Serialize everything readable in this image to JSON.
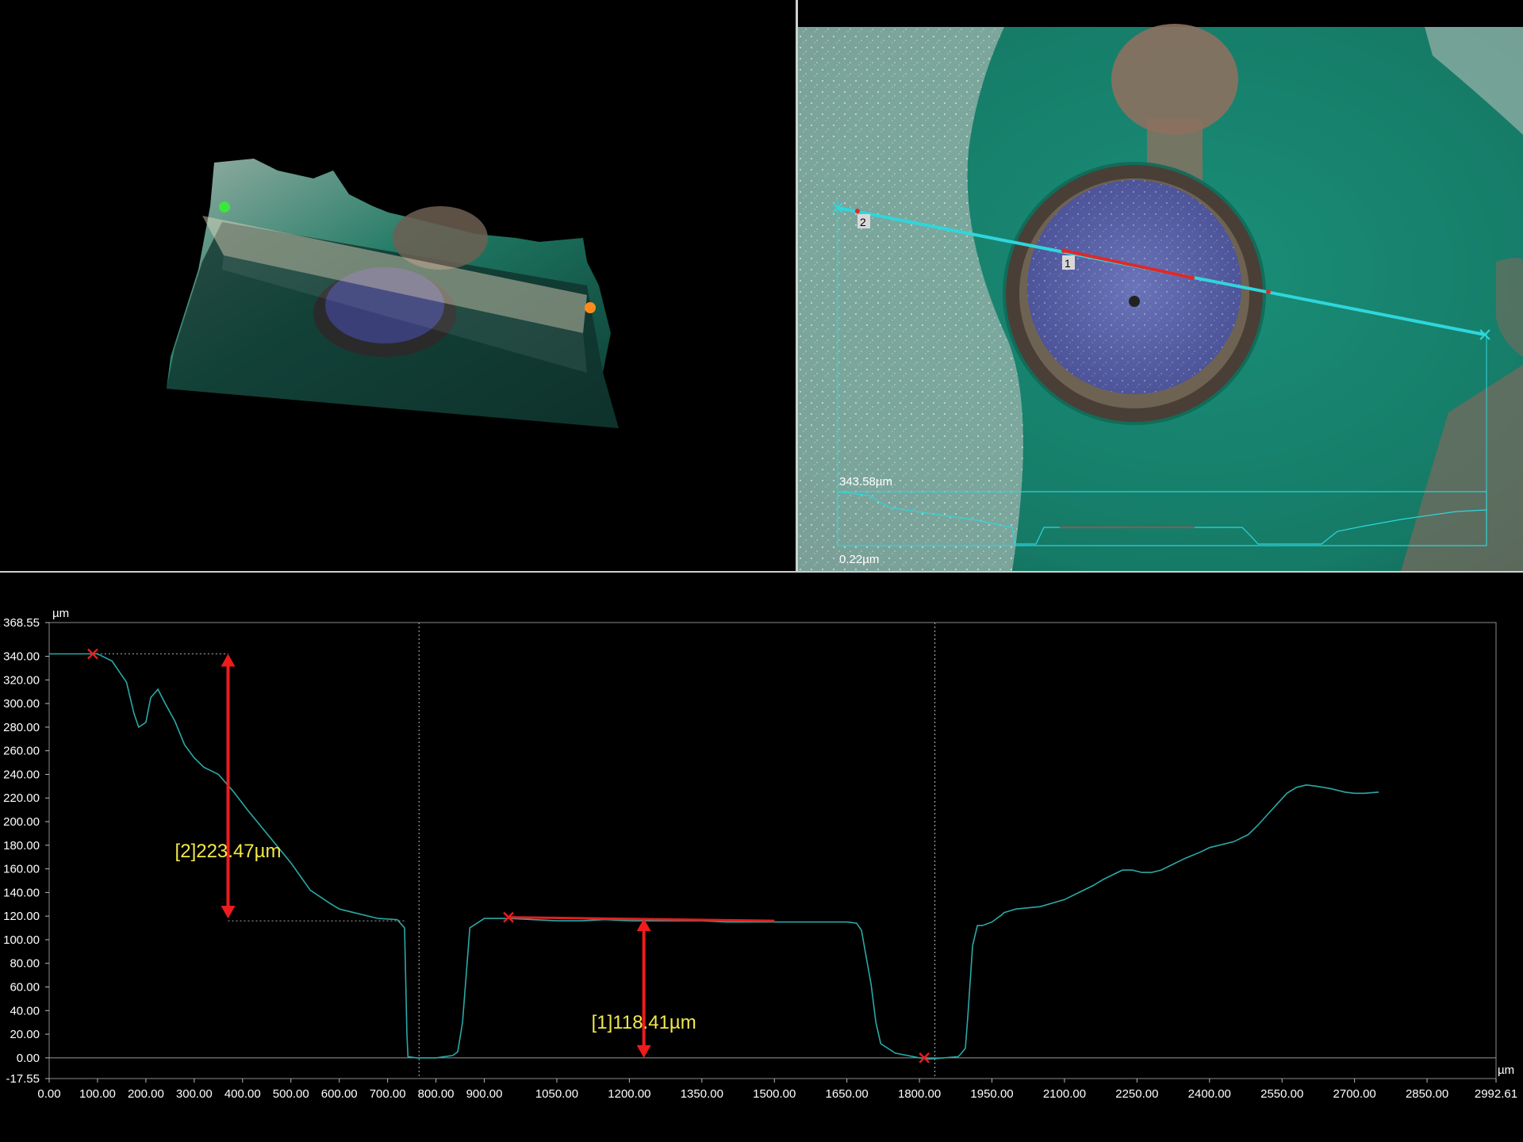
{
  "view_2d": {
    "profile_inset_max": "343.58µm",
    "profile_inset_min": "0.22µm",
    "marker_1": "1",
    "marker_2": "2"
  },
  "chart_data": {
    "type": "line",
    "xlabel": "µm",
    "ylabel": "µm",
    "xlim": [
      0,
      2992.61
    ],
    "ylim": [
      -17.55,
      368.55
    ],
    "x_ticks": [
      "0.00",
      "100.00",
      "200.00",
      "300.00",
      "400.00",
      "500.00",
      "600.00",
      "700.00",
      "800.00",
      "900.00",
      "1050.00",
      "1200.00",
      "1350.00",
      "1500.00",
      "1650.00",
      "1800.00",
      "1950.00",
      "2100.00",
      "2250.00",
      "2400.00",
      "2550.00",
      "2700.00",
      "2850.00",
      "2992.61"
    ],
    "x_tick_values": [
      0,
      100,
      200,
      300,
      400,
      500,
      600,
      700,
      800,
      900,
      1050,
      1200,
      1350,
      1500,
      1650,
      1800,
      1950,
      2100,
      2250,
      2400,
      2550,
      2700,
      2850,
      2992.61
    ],
    "y_ticks": [
      "368.55",
      "340.00",
      "320.00",
      "300.00",
      "280.00",
      "260.00",
      "240.00",
      "220.00",
      "200.00",
      "180.00",
      "160.00",
      "140.00",
      "120.00",
      "100.00",
      "80.00",
      "60.00",
      "40.00",
      "20.00",
      "0.00",
      "-17.55"
    ],
    "y_tick_values": [
      368.55,
      340,
      320,
      300,
      280,
      260,
      240,
      220,
      200,
      180,
      160,
      140,
      120,
      100,
      80,
      60,
      40,
      20,
      0,
      -17.55
    ],
    "series": [
      {
        "x": [
          0,
          100,
          130,
          160,
          175,
          185,
          200,
          210,
          225,
          240,
          260,
          280,
          300,
          320,
          350,
          380,
          410,
          450,
          500,
          540,
          580,
          600,
          640,
          680,
          720,
          735,
          740,
          742,
          760,
          800,
          835,
          845,
          855,
          870,
          900,
          950,
          1000,
          1050,
          1100,
          1150,
          1200,
          1250,
          1300,
          1350,
          1400,
          1450,
          1500,
          1550,
          1600,
          1650,
          1670,
          1680,
          1700,
          1710,
          1720,
          1750,
          1800,
          1820,
          1850,
          1880,
          1885,
          1895,
          1900,
          1910,
          1920,
          1930,
          1950,
          1960,
          1970,
          1975,
          2000,
          2050,
          2100,
          2130,
          2160,
          2180,
          2200,
          2220,
          2240,
          2260,
          2280,
          2300,
          2320,
          2350,
          2380,
          2400,
          2450,
          2480,
          2500,
          2520,
          2540,
          2560,
          2580,
          2600,
          2620,
          2650,
          2680,
          2700,
          2720,
          2750
        ],
        "y": [
          342,
          342,
          336,
          318,
          292,
          280,
          284,
          305,
          312,
          300,
          285,
          265,
          254,
          246,
          240,
          226,
          210,
          190,
          165,
          142,
          131,
          126,
          122,
          118,
          117,
          110,
          20,
          1,
          0,
          0,
          2,
          5,
          30,
          110,
          118,
          118,
          117,
          116,
          116,
          117,
          116,
          116,
          116,
          116,
          115,
          115,
          115,
          115,
          115,
          115,
          114,
          108,
          62,
          30,
          12,
          4,
          0,
          -1,
          0,
          1,
          3,
          8,
          35,
          95,
          112,
          112,
          115,
          118,
          121,
          123,
          126,
          128,
          134,
          140,
          146,
          151,
          155,
          159,
          159,
          157,
          157,
          159,
          163,
          169,
          174,
          178,
          183,
          189,
          197,
          206,
          215,
          224,
          229,
          231,
          230,
          228,
          225,
          224,
          224,
          225
        ]
      }
    ],
    "red_segment": {
      "x": [
        950,
        1500
      ],
      "y": [
        119,
        116
      ]
    },
    "cursor_lines_x": [
      765,
      1832
    ],
    "points": [
      {
        "x": 90,
        "y": 342
      },
      {
        "x": 950,
        "y": 119
      },
      {
        "x": 1810,
        "y": 0
      }
    ],
    "measurements": [
      {
        "label": "[2]223.47µm",
        "x": 370,
        "y_top": 342,
        "y_bottom": 118,
        "label_y": 175
      },
      {
        "label": "[1]118.41µm",
        "x": 1230,
        "y_top": 118,
        "y_bottom": 0,
        "label_y": 30
      }
    ]
  }
}
